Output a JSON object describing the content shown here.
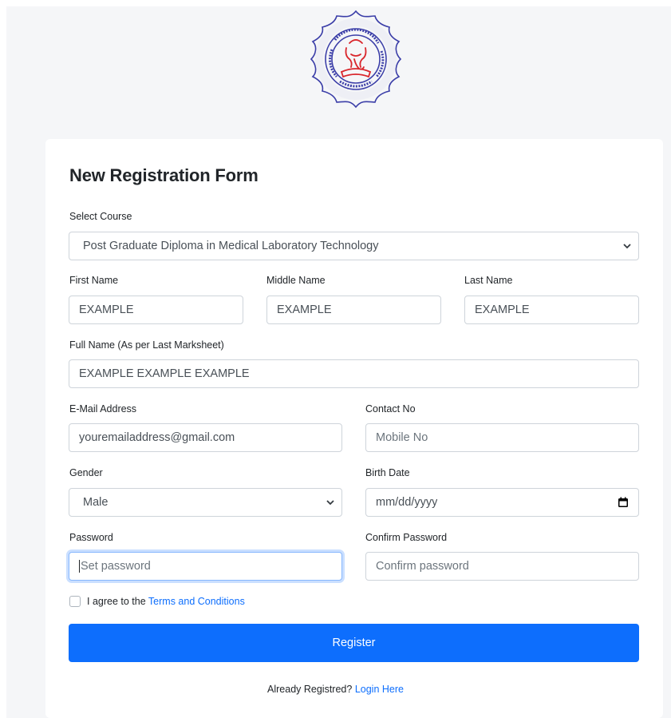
{
  "colors": {
    "accent": "#0d6efd",
    "page_bg": "#f5f6f8",
    "card_bg": "#ffffff",
    "border": "#ced4da",
    "logo_blue": "#3b3ea8",
    "logo_red": "#d9262c"
  },
  "logo": {
    "icon": "university-seal-logo",
    "ring_text": "GUJARAT UNIVERSITY OF TRANSPLANTATION SCIENCES"
  },
  "form": {
    "title": "New Registration Form",
    "course": {
      "label": "Select Course",
      "value": "Post Graduate Diploma in Medical Laboratory Technology"
    },
    "first_name": {
      "label": "First Name",
      "value": "EXAMPLE"
    },
    "middle_name": {
      "label": "Middle Name",
      "value": "EXAMPLE"
    },
    "last_name": {
      "label": "Last Name",
      "value": "EXAMPLE"
    },
    "full_name": {
      "label": "Full Name (As per Last Marksheet)",
      "value": "EXAMPLE EXAMPLE EXAMPLE"
    },
    "email": {
      "label": "E-Mail Address",
      "value": "youremailaddress@gmail.com"
    },
    "contact": {
      "label": "Contact No",
      "placeholder": "Mobile No"
    },
    "gender": {
      "label": "Gender",
      "value": "Male"
    },
    "birth_date": {
      "label": "Birth Date",
      "placeholder": "mm/dd/yyyy"
    },
    "password": {
      "label": "Password",
      "placeholder": "Set password"
    },
    "confirm_password": {
      "label": "Confirm Password",
      "placeholder": "Confirm password"
    },
    "agree": {
      "text": "I agree to the",
      "link": "Terms and Conditions",
      "checked": false
    },
    "register_label": "Register",
    "footer": {
      "text": "Already Registred?",
      "link": "Login Here"
    }
  }
}
